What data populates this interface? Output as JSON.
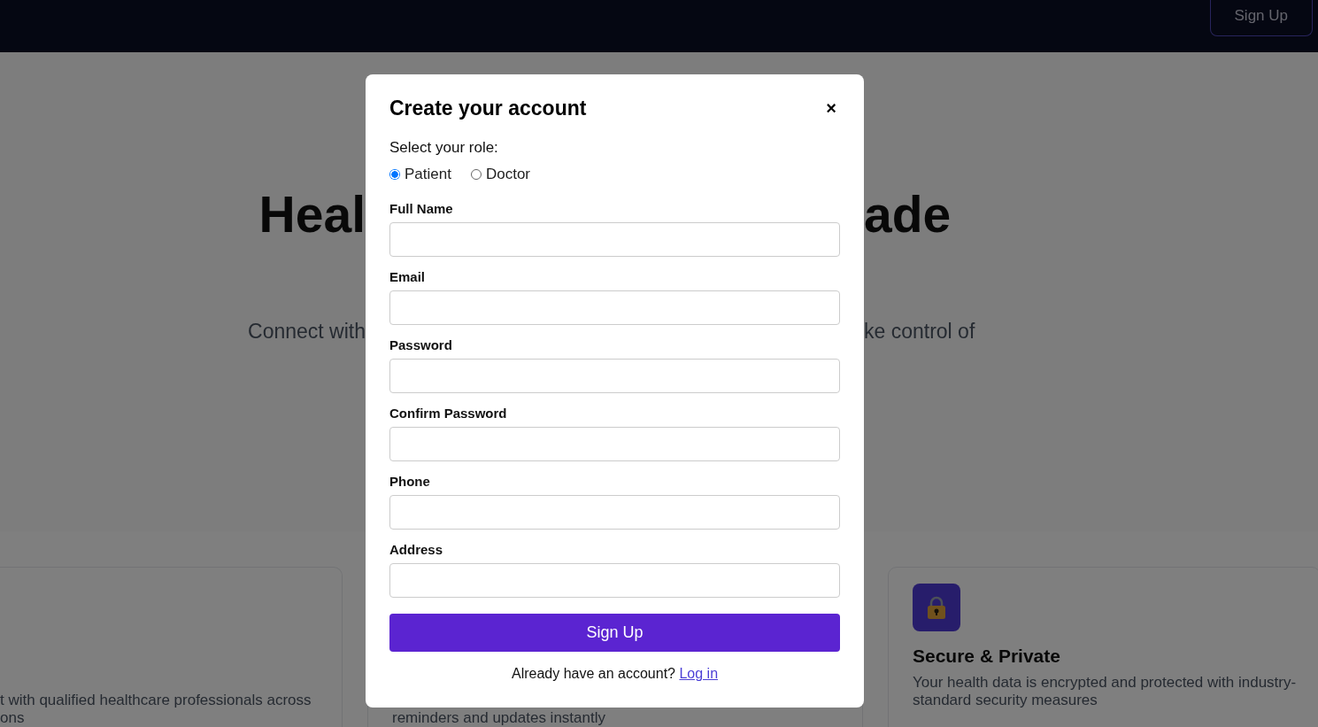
{
  "nav": {
    "button": "Sign Up"
  },
  "hero": {
    "title_left": "Heal",
    "title_right": "ade",
    "subtitle_left": "Connect with",
    "subtitle_right": "ke control of"
  },
  "features": [
    {
      "kind": "text",
      "lines": [
        "t with qualified healthcare professionals across",
        "ons"
      ]
    },
    {
      "kind": "text",
      "lines": [
        "reminders and updates instantly"
      ]
    },
    {
      "kind": "full",
      "title": "Secure & Private",
      "lines": [
        "Your health data is encrypted and protected with industry-",
        "standard security measures"
      ]
    }
  ],
  "modal": {
    "title": "Create your account",
    "close": "×",
    "role_label": "Select your role:",
    "roles": [
      {
        "label": "Patient",
        "selected": true
      },
      {
        "label": "Doctor",
        "selected": false
      }
    ],
    "fields": [
      {
        "label": "Full Name"
      },
      {
        "label": "Email"
      },
      {
        "label": "Password"
      },
      {
        "label": "Confirm Password"
      },
      {
        "label": "Phone"
      },
      {
        "label": "Address"
      }
    ],
    "submit": "Sign Up",
    "footer_text": "Already have an account?",
    "footer_link": "Log in"
  }
}
